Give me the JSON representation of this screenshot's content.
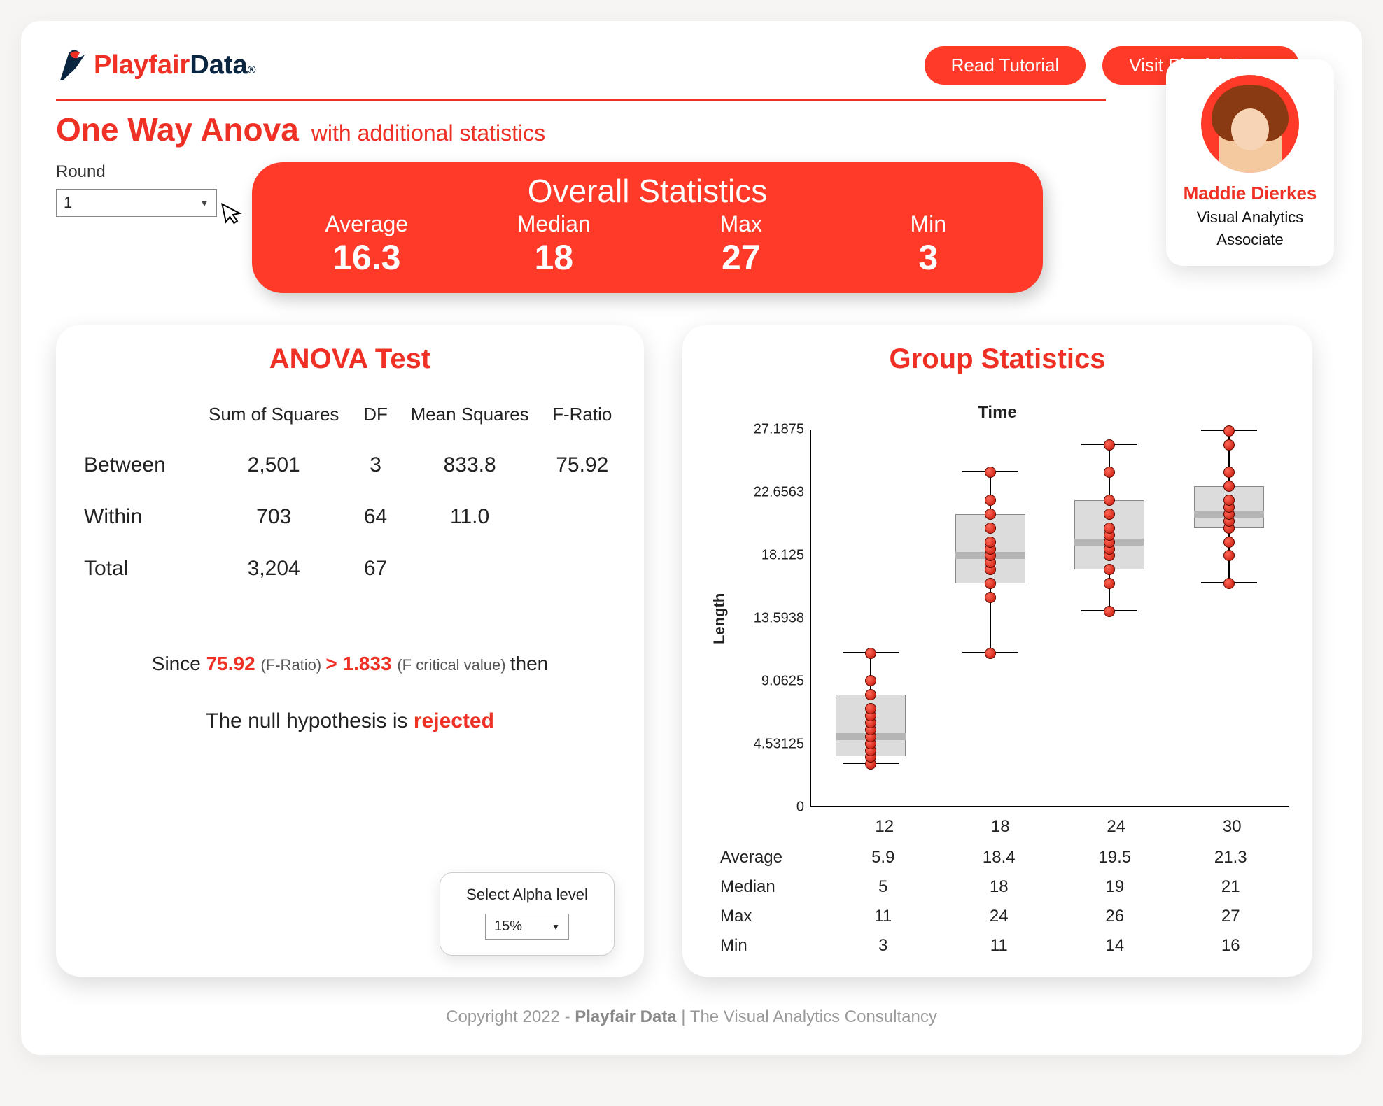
{
  "brand": {
    "play": "Playfair",
    "data": "Data",
    "reg": "®"
  },
  "header_buttons": {
    "tutorial": "Read Tutorial",
    "visit": "Visit Playfair Data"
  },
  "person": {
    "name": "Maddie Dierkes",
    "role1": "Visual Analytics",
    "role2": "Associate"
  },
  "title": {
    "main": "One Way Anova",
    "sub": "with additional statistics"
  },
  "round": {
    "label": "Round",
    "value": "1"
  },
  "overall": {
    "title": "Overall Statistics",
    "labels": {
      "avg": "Average",
      "med": "Median",
      "max": "Max",
      "min": "Min"
    },
    "values": {
      "avg": "16.3",
      "med": "18",
      "max": "27",
      "min": "3"
    }
  },
  "anova": {
    "title": "ANOVA Test",
    "cols": {
      "ss": "Sum of Squares",
      "df": "DF",
      "ms": "Mean Squares",
      "fr": "F-Ratio"
    },
    "rows": {
      "between": {
        "label": "Between",
        "ss": "2,501",
        "df": "3",
        "ms": "833.8",
        "fr": "75.92"
      },
      "within": {
        "label": "Within",
        "ss": "703",
        "df": "64",
        "ms": "11.0",
        "fr": ""
      },
      "total": {
        "label": "Total",
        "ss": "3,204",
        "df": "67",
        "ms": "",
        "fr": ""
      }
    },
    "conclusion": {
      "since": "Since ",
      "fr": "75.92",
      "fr_note": " (F-Ratio) ",
      "gt": "> ",
      "fc": "1.833",
      "fc_note": " (F critical value) ",
      "then": "then",
      "null_prefix": "The null hypothesis is ",
      "null_result": "rejected"
    },
    "alpha": {
      "label": "Select Alpha level",
      "value": "15%"
    }
  },
  "groups": {
    "title": "Group Statistics",
    "xtitle": "Time",
    "ytitle": "Length",
    "yticks": [
      "27.1875",
      "22.6563",
      "18.125",
      "13.5938",
      "9.0625",
      "4.53125",
      "0"
    ],
    "categories": [
      "12",
      "18",
      "24",
      "30"
    ],
    "summary_rows": {
      "avg": {
        "label": "Average",
        "v": [
          "5.9",
          "18.4",
          "19.5",
          "21.3"
        ]
      },
      "med": {
        "label": "Median",
        "v": [
          "5",
          "18",
          "19",
          "21"
        ]
      },
      "max": {
        "label": "Max",
        "v": [
          "11",
          "24",
          "26",
          "27"
        ]
      },
      "min": {
        "label": "Min",
        "v": [
          "3",
          "11",
          "14",
          "16"
        ]
      }
    }
  },
  "footer": {
    "copy": "Copyright 2022 - ",
    "brand": "Playfair Data",
    "rest": " | The Visual Analytics Consultancy"
  },
  "chart_data": {
    "type": "boxplot",
    "title": "Group Statistics",
    "xlabel": "Time",
    "ylabel": "Length",
    "ylim": [
      0,
      27.1875
    ],
    "categories": [
      12,
      18,
      24,
      30
    ],
    "series": [
      {
        "name": "12",
        "min": 3,
        "q1": 3.6,
        "median": 5,
        "q3": 8,
        "max": 11,
        "points": [
          3,
          3.5,
          4,
          4.5,
          5,
          5.5,
          6,
          6.5,
          7,
          8,
          9,
          11
        ]
      },
      {
        "name": "18",
        "min": 11,
        "q1": 16,
        "median": 18,
        "q3": 21,
        "max": 24,
        "points": [
          11,
          15,
          16,
          17,
          17.5,
          18,
          18.5,
          19,
          20,
          21,
          22,
          24
        ]
      },
      {
        "name": "24",
        "min": 14,
        "q1": 17,
        "median": 19,
        "q3": 22,
        "max": 26,
        "points": [
          14,
          16,
          17,
          18,
          18.5,
          19,
          19.5,
          20,
          21,
          22,
          24,
          26
        ]
      },
      {
        "name": "30",
        "min": 16,
        "q1": 20,
        "median": 21,
        "q3": 23,
        "max": 27,
        "points": [
          16,
          18,
          19,
          20,
          20.5,
          21,
          21.5,
          22,
          23,
          24,
          26,
          27
        ]
      }
    ],
    "yticks": [
      0,
      4.53125,
      9.0625,
      13.5938,
      18.125,
      22.6563,
      27.1875
    ]
  }
}
